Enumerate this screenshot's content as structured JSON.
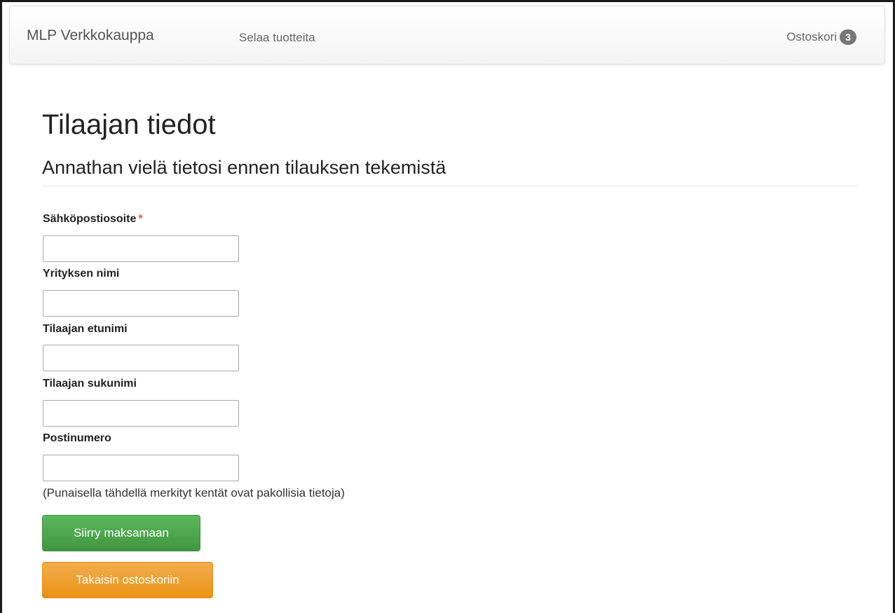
{
  "navbar": {
    "brand": "MLP Verkkokauppa",
    "browse_link": "Selaa tuotteita",
    "cart_label": "Ostoskori",
    "cart_count": "3"
  },
  "page": {
    "title": "Tilaajan tiedot",
    "subtitle": "Annathan vielä tietosi ennen tilauksen tekemistä"
  },
  "form": {
    "fields": [
      {
        "label": "Sähköpostiosoite",
        "required": true,
        "value": ""
      },
      {
        "label": "Yrityksen nimi",
        "required": false,
        "value": ""
      },
      {
        "label": "Tilaajan etunimi",
        "required": false,
        "value": ""
      },
      {
        "label": "Tilaajan sukunimi",
        "required": false,
        "value": ""
      },
      {
        "label": "Postinumero",
        "required": false,
        "value": ""
      }
    ],
    "required_marker": "*",
    "help_text": "(Punaisella tähdellä merkityt kentät ovat pakollisia tietoja)",
    "submit_label": "Siirry maksamaan",
    "back_label": "Takaisin ostoskoriin"
  },
  "colors": {
    "required": "#d9534f",
    "success": "#5cb85c",
    "warning": "#f0ad4e",
    "badge": "#777777"
  }
}
